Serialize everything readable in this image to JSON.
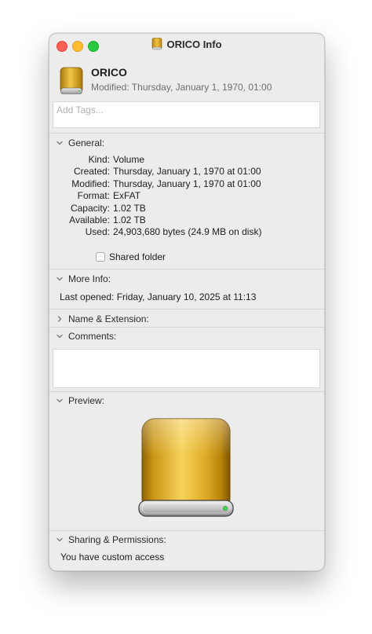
{
  "window": {
    "title": "ORICO Info"
  },
  "header": {
    "file_name": "ORICO",
    "modified_line": "Modified: Thursday, January 1, 1970, 01:00"
  },
  "tags": {
    "placeholder": "Add Tags..."
  },
  "general": {
    "label": "General:",
    "expanded": true,
    "rows": [
      {
        "key": "Kind:",
        "value": "Volume"
      },
      {
        "key": "Created:",
        "value": "Thursday, January 1, 1970 at 01:00"
      },
      {
        "key": "Modified:",
        "value": "Thursday, January 1, 1970 at 01:00"
      },
      {
        "key": "Format:",
        "value": "ExFAT"
      },
      {
        "key": "Capacity:",
        "value": "1.02 TB"
      },
      {
        "key": "Available:",
        "value": "1.02 TB"
      },
      {
        "key": "Used:",
        "value": "24,903,680 bytes (24.9 MB on disk)"
      }
    ],
    "shared_folder_label": "Shared folder",
    "shared_folder_checked": false
  },
  "more_info": {
    "label": "More Info:",
    "expanded": true,
    "last_opened": "Last opened: Friday, January 10, 2025 at 11:13"
  },
  "name_extension": {
    "label": "Name & Extension:",
    "expanded": false
  },
  "comments": {
    "label": "Comments:",
    "expanded": true,
    "value": ""
  },
  "preview": {
    "label": "Preview:",
    "expanded": true,
    "icon": "external-drive-icon"
  },
  "sharing": {
    "label": "Sharing & Permissions:",
    "expanded": true,
    "text": "You have custom access"
  },
  "colors": {
    "window_bg": "#ececec",
    "close": "#fe5f57",
    "minimize": "#febc2e",
    "zoom": "#28c840",
    "drive_gold": "#d9a521"
  }
}
